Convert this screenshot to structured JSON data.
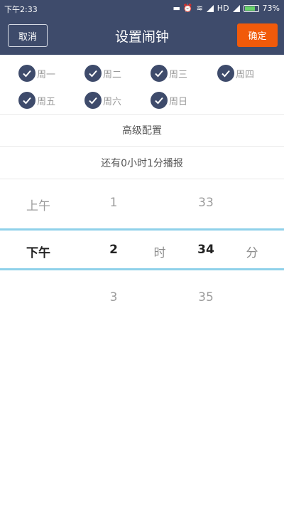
{
  "statusbar": {
    "time": "下午2:33",
    "network": "HD",
    "battery": "73%"
  },
  "header": {
    "cancel_label": "取消",
    "title": "设置闹钟",
    "confirm_label": "确定"
  },
  "days": [
    {
      "label": "周一",
      "checked": true
    },
    {
      "label": "周二",
      "checked": true
    },
    {
      "label": "周三",
      "checked": true
    },
    {
      "label": "周四",
      "checked": true
    },
    {
      "label": "周五",
      "checked": true
    },
    {
      "label": "周六",
      "checked": true
    },
    {
      "label": "周日",
      "checked": true
    }
  ],
  "advanced_label": "高级配置",
  "remaining_text": "还有0小时1分播报",
  "picker": {
    "ampm": {
      "above": "上午",
      "selected": "下午"
    },
    "hour": {
      "above": "1",
      "selected": "2",
      "below": "3"
    },
    "hour_unit": "时",
    "minute": {
      "above": "33",
      "selected": "34",
      "below": "35"
    },
    "minute_unit": "分"
  },
  "colors": {
    "header": "#3e4b6b",
    "confirm": "#f15a0a",
    "picker_line": "#8fd1ea",
    "check": "#3e4b6b"
  }
}
